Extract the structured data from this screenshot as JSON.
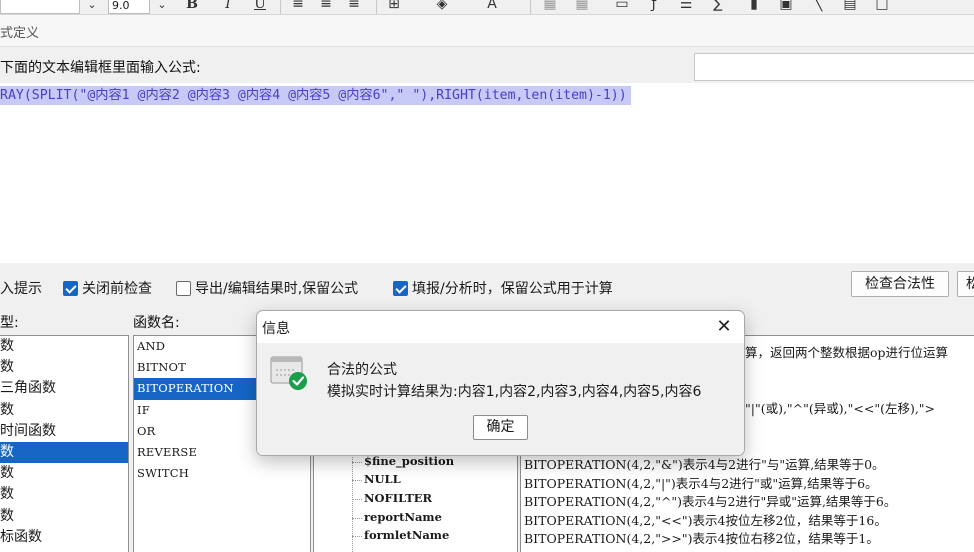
{
  "toolbar": {
    "font_size_value": "9.0",
    "bold_label": "B",
    "italic_label": "I",
    "underline_label": "U"
  },
  "window": {
    "title": "式定义"
  },
  "editor": {
    "prompt_label": "下面的文本编辑框里面输入公式:",
    "formula_text": "RAY(SPLIT(\"@内容1 @内容2 @内容3 @内容4 @内容5 @内容6\",\" \"),RIGHT(item,len(item)-1))"
  },
  "options": {
    "input_hint": "入提示",
    "check_before_close": "关闭前检查",
    "check_before_close_checked": true,
    "keep_formula_export": "导出/编辑结果时,保留公式",
    "keep_formula_export_checked": false,
    "keep_formula_fill": "填报/分析时，保留公式用于计算",
    "keep_formula_fill_checked": true,
    "check_validity_button": "检查合法性",
    "next_button": "松"
  },
  "sections": {
    "type_label": "型:",
    "function_name_label": "函数名:"
  },
  "categories": [
    {
      "label": "数",
      "selected": false
    },
    {
      "label": "数",
      "selected": false
    },
    {
      "label": "三角函数",
      "selected": false
    },
    {
      "label": "数",
      "selected": false
    },
    {
      "label": "时间函数",
      "selected": false
    },
    {
      "label": "数",
      "selected": true
    },
    {
      "label": "数",
      "selected": false
    },
    {
      "label": "数",
      "selected": false
    },
    {
      "label": "数",
      "selected": false
    },
    {
      "label": "标函数",
      "selected": false
    }
  ],
  "functions": [
    {
      "name": "AND",
      "selected": false
    },
    {
      "name": "BITNOT",
      "selected": false
    },
    {
      "name": "BITOPERATION",
      "selected": true
    },
    {
      "name": "IF",
      "selected": false
    },
    {
      "name": "OR",
      "selected": false
    },
    {
      "name": "REVERSE",
      "selected": false
    },
    {
      "name": "SWITCH",
      "selected": false
    }
  ],
  "tree_items": [
    "$fine_position",
    "NULL",
    "NOFILTER",
    "reportName",
    "formletName"
  ],
  "description": {
    "line1_partial": "算，返回两个整数根据op进行位运算",
    "line2_partial": "\"|\"(或),\"^\"(异或),\"<<\"(左移),\">",
    "examples": [
      "BITOPERATION(4,2,\"&\")表示4与2进行\"与\"运算,结果等于0。",
      "BITOPERATION(4,2,\"|\")表示4与2进行\"或\"运算,结果等于6。",
      "BITOPERATION(4,2,\"^\")表示4与2进行\"异或\"运算,结果等于6。",
      "BITOPERATION(4,2,\"<<\")表示4按位左移2位，结果等于16。",
      "BITOPERATION(4,2,\">>\")表示4按位右移2位，结果等于1。"
    ]
  },
  "dialog": {
    "title": "信息",
    "message_title": "合法的公式",
    "message_result": "模拟实时计算结果为:内容1,内容2,内容3,内容4,内容5,内容6",
    "ok_button": "确定",
    "close_symbol": "✕"
  },
  "icons": {
    "success_color": "#1a9e4b",
    "selection_color": "#1566c5"
  }
}
